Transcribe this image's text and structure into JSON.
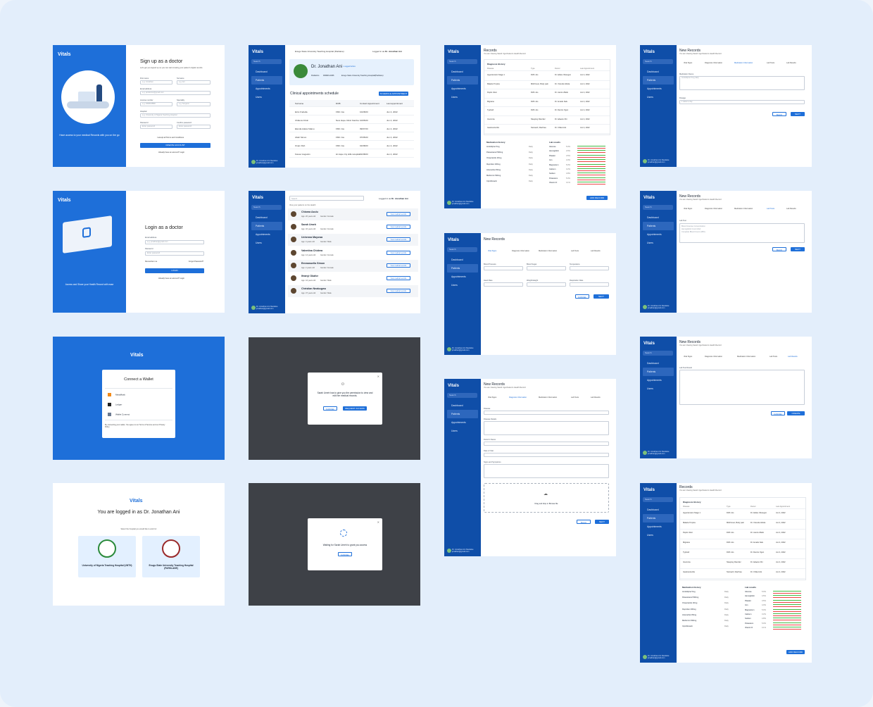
{
  "brand": {
    "name": "Vitals",
    "accent": "#1e6fd9",
    "sidebar": "#0f4ea8"
  },
  "signup": {
    "title": "Sign up as a doctor",
    "subtitle": "Let's get you signed up so you can start creating your patient's digital records",
    "tagline": "Have access to your medical Records with you on the go",
    "fields": [
      "First name",
      "Surname",
      "Email address",
      "License number",
      "Speciality",
      "Hospital",
      "Password",
      "Confirm password"
    ],
    "placeholders": [
      "e.g. Jonathan",
      "e.g. Ani",
      "e.g. janidoctor@gmail.com",
      "e.g. DRM345BD",
      "e.g. Surgeon",
      "e.g. University of Nigeria Teaching Hospital",
      "Enter password",
      "Enter password"
    ],
    "terms": "I accept all Terms and Conditions",
    "button": "CREATE ACCOUNT",
    "footer": "Already have an account? Login"
  },
  "login": {
    "title": "Login as a doctor",
    "tagline": "Access and Share your Health Record with ease",
    "email_label": "Email address",
    "email_ph": "e.g. jonathan@gmail.com",
    "password_label": "Password",
    "password_ph": "Enter password",
    "remember": "Remember me",
    "forgot": "Forgot Password?",
    "button": "LOGIN",
    "footer": "Already have an account? Login"
  },
  "wallet": {
    "logo": "Vitals",
    "title": "Connect a Wallet",
    "options": [
      "MetaMask",
      "Ledger",
      "Wallet Connect"
    ],
    "note": "By connecting your wallet, You agree to our Terms of Service and our Privacy Policy"
  },
  "loggedin": {
    "logo": "Vitals",
    "title": "You are logged in as Dr. Jonathan Ani",
    "hint": "Select the hospital you would like to work for",
    "hospitals": [
      "University of Nigeria Teaching Hospital (UNTH)",
      "Enugu State University Teaching Hospital (PARKLANE)"
    ]
  },
  "sidebar": {
    "logo": "Vitals",
    "search": "Search",
    "nav": [
      "Dashboard",
      "Patients",
      "Appointments",
      "Users"
    ],
    "user": "Dr. Jonathan Ani Nwokeke",
    "email": "jonathan@gmail.com"
  },
  "dashboard": {
    "hospital": "Enugu State University Teaching Hospital (Parklane)",
    "logged_as": "Logged in as",
    "doctor": "Dr. Jonathan Ani",
    "profile_name": "Dr. Jonathan Ani",
    "badge": "• Logged Active",
    "specialty": "Pediatrics",
    "license": "DRM23-4466",
    "hospital_short": "Enugu State University Teaching Hospital(Parklane)",
    "section": "Clinical appointments schedule",
    "button": "SCHEDULE APPOINTMENT",
    "columns": [
      "Surname",
      "DOB",
      "Contact Appointment",
      "Last appointment"
    ],
    "rows": [
      [
        "Ezra Frebelle",
        "FMC Jos",
        "10/28/23",
        "Jun 4, 2022"
      ],
      [
        "Chidera Ozioli",
        "New Hope Clinic Kamba",
        "10/05/23",
        "Jun 4, 2022"
      ],
      [
        "Elenda Adeta Ndanu",
        "FMC Jos",
        "09/07/23",
        "Jun 4, 2022"
      ],
      [
        "Abah Simon",
        "FMC Jos",
        "07/05/23",
        "Jun 4, 2022"
      ],
      [
        "Ovam Ruh",
        "FMC Jos",
        "01/08/23",
        "Jun 4, 2022"
      ],
      [
        "Favour Augustin",
        "Hi Hope Cty Hills Hospital",
        "01/08/23",
        "Jun 4, 2022"
      ]
    ]
  },
  "patients": {
    "search": "Search",
    "logged_as": "Logged in as",
    "doctor": "Dr. Jonathan Ani",
    "subtitle": "View your patients on the Health",
    "view": "View medical records",
    "list": [
      [
        "Chioma Azulu",
        "Age: 20 years old",
        "Gender: Female"
      ],
      [
        "Sarah Umeh",
        "Age: 32 years old",
        "Gender: Female"
      ],
      [
        "Uchenna Mayowa",
        "Age: 3 years old",
        "Gender: Male"
      ],
      [
        "Valentina Chidera",
        "Age: 14 years old",
        "Gender: Female"
      ],
      [
        "Emmanuella Simon",
        "Age: 2 years old",
        "Gender: Female"
      ],
      [
        "Ifeanyi Okafor",
        "Age: 44 years old",
        "Gender: Male"
      ],
      [
        "Christian Nnabugwu",
        "Age: 37 years old",
        "Gender: Male"
      ]
    ]
  },
  "modal1": {
    "text": "Sarah Umeh has to give you the permission to view and edit her medical records.",
    "cancel": "CANCEL",
    "confirm": "REQUEST ACCESS"
  },
  "modal2": {
    "text": "Waiting for Sarah Umeh to grant you access",
    "cancel": "CANCEL"
  },
  "records": {
    "title": "Records",
    "subtitle": "You are Viewing Sarah Ugochukwu's Health Record",
    "diagnosis": "Diagnosis History",
    "cols": [
      "Disease",
      "Type",
      "Doctor",
      "Last Appointment"
    ],
    "rows": [
      [
        "Hypertension Stage 1",
        "FMC Jos",
        "Dr. Adeku Olusegun",
        "Jun 4, 2022"
      ],
      [
        "Malaria Tropica",
        "Mild Fever, Body pain",
        "Dr. Yetunde Abiola",
        "Jun 4, 2022"
      ],
      [
        "Peptic Ulcer",
        "FMC Jos",
        "Dr. Jaminu Bello",
        "Jun 4, 2022"
      ],
      [
        "Migraine",
        "FMC Jos",
        "Dr. Amadu Kalu",
        "Jun 4, 2022"
      ],
      [
        "Typhoid",
        "FMC Jos",
        "Dr. Dennis Ogun",
        "Jun 4, 2022"
      ],
      [
        "Insomnia",
        "Sleeping Disorder",
        "Dr. Adaeze Obi",
        "Jun 4, 2022"
      ],
      [
        "Gastroenteritis",
        "Stomach, Diarrhea",
        "Dr. Chika Udo",
        "Jun 4, 2022"
      ]
    ],
    "meds_title": "Medication history",
    "labs_title": "Lab results",
    "meds": [
      [
        "Amlodipine 5mg",
        "Daily"
      ],
      [
        "Paracetamol 500mg",
        "Daily"
      ],
      [
        "Omeprazole 20mg",
        "Daily"
      ],
      [
        "Ibuprofen 200mg",
        "Daily"
      ],
      [
        "Artemether 80mg",
        "Daily"
      ],
      [
        "Metformin 500mg",
        "Daily"
      ],
      [
        "Ciprofloxacin",
        "Daily"
      ]
    ],
    "labs": [
      [
        "Glucose",
        "5.0%"
      ],
      [
        "Hemoglobin",
        "4.5%"
      ],
      [
        "Platelet",
        "3.5%"
      ],
      [
        "Iron",
        "4.0%"
      ],
      [
        "Magnesium",
        "5.0%"
      ],
      [
        "Calcium",
        "3.2%"
      ],
      [
        "Sodium",
        "4.8%"
      ],
      [
        "Potassium",
        "5.0%"
      ],
      [
        "Vitamin D",
        "4.1%"
      ]
    ],
    "button": "ADD RECORD"
  },
  "newrec": {
    "title": "New Records",
    "subtitle": "You are Viewing Sarah Ugochukwu's Health Record",
    "tabs": [
      "Vital Signs",
      "Diagnosis Information",
      "Medication Information",
      "Lab Tests",
      "Lab Results"
    ],
    "back": "BACK",
    "next": "NEXT",
    "cancel": "CANCEL",
    "upload": "Drag and drop or Browse file",
    "fields": [
      "Blood Pressure",
      "Blood Sugar",
      "Temperature",
      "Heart Rate",
      "Weight/Height",
      "Respiration Rate"
    ],
    "diag_fields": [
      "Disease",
      "Disease Details",
      "Doctor's Name",
      "Date of Visit",
      "Signs and Symptoms"
    ],
    "med_label": "Medication Name",
    "med_ph": "Amlodipine 5mg daily",
    "dosage": "Dosage",
    "dosage_ph": "1 tablet a day",
    "lab_label": "Lab Test",
    "lab_items": [
      "Blood Glucose Concentration",
      "Hemoglobin Count HbA",
      "Complete Blood Count (CBC)"
    ],
    "result_label": "Lab Test Result",
    "create": "CREATE RECORD"
  }
}
